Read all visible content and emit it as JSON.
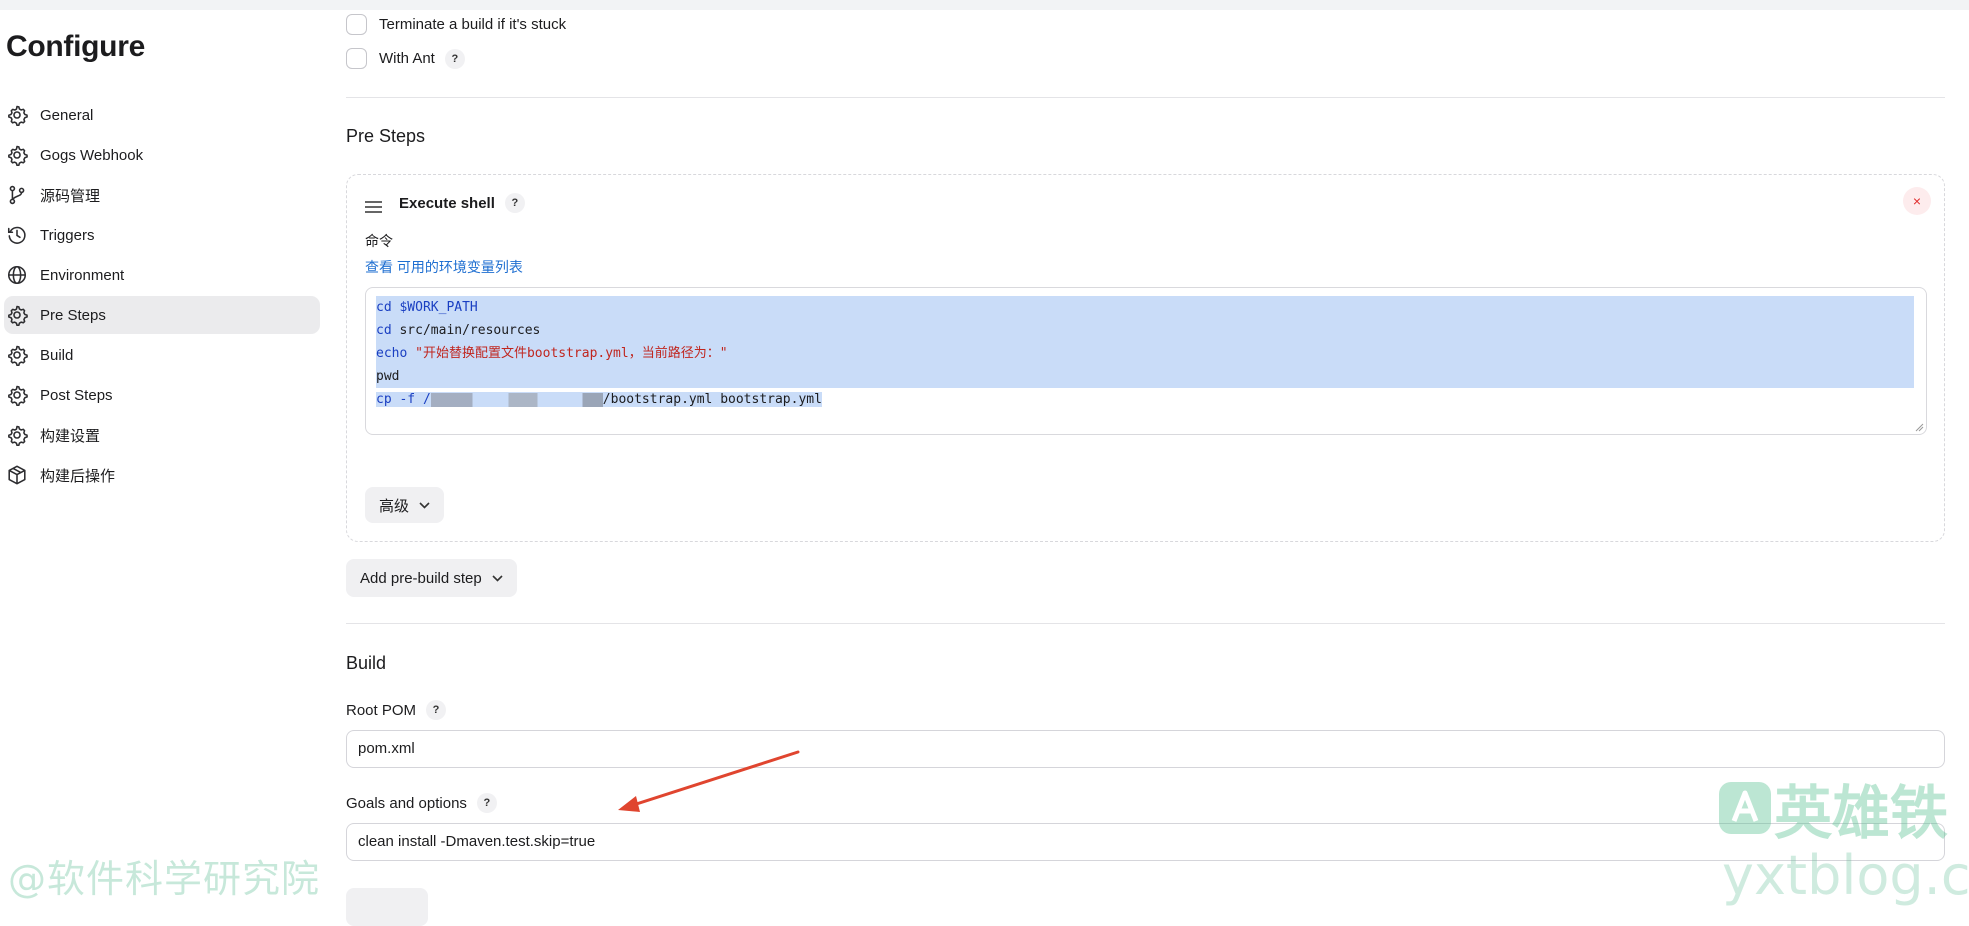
{
  "sidebar": {
    "title": "Configure",
    "items": [
      {
        "label": "General",
        "icon": "gear-icon"
      },
      {
        "label": "Gogs Webhook",
        "icon": "gear-icon"
      },
      {
        "label": "源码管理",
        "icon": "git-branch-icon"
      },
      {
        "label": "Triggers",
        "icon": "clock-icon"
      },
      {
        "label": "Environment",
        "icon": "globe-icon"
      },
      {
        "label": "Pre Steps",
        "icon": "gear-icon",
        "active": true
      },
      {
        "label": "Build",
        "icon": "gear-icon"
      },
      {
        "label": "Post Steps",
        "icon": "gear-icon"
      },
      {
        "label": "构建设置",
        "icon": "gear-icon"
      },
      {
        "label": "构建后操作",
        "icon": "cube-icon"
      }
    ]
  },
  "options": {
    "terminate_label": "Terminate a build if it's stuck",
    "with_ant_label": "With Ant",
    "help": "?"
  },
  "pre_steps": {
    "title": "Pre Steps",
    "step": {
      "title": "Execute shell",
      "close": "×",
      "command_label": "命令",
      "env_prefix": "查看",
      "env_link": "可用的环境变量列表",
      "code": {
        "l1_kw": "cd",
        "l1_var": "$WORK_PATH",
        "l2_kw": "cd",
        "l2_rest": "src/main/resources",
        "l3_kw": "echo",
        "l3_str": "\"开始替换配置文件bootstrap.yml，当前路径为：\"",
        "l4": "pwd",
        "l5_kw": "cp",
        "l5_flag": "-f /",
        "l5_rest": "/bootstrap.yml bootstrap.yml"
      },
      "advanced": "高级"
    },
    "add_button": "Add pre-build step"
  },
  "build": {
    "title": "Build",
    "root_pom_label": "Root POM",
    "root_pom_value": "pom.xml",
    "goals_label": "Goals and options",
    "goals_value": "clean install -Dmaven.test.skip=true"
  },
  "watermarks": {
    "left": "@软件科学研究院",
    "right_cn": "英雄铁",
    "right_url": "yxtblog.com"
  },
  "colors": {
    "accent_link": "#1f6fd1",
    "selection": "#c9dcf8",
    "arrow": "#e0452f",
    "close": "#e02c2c"
  }
}
